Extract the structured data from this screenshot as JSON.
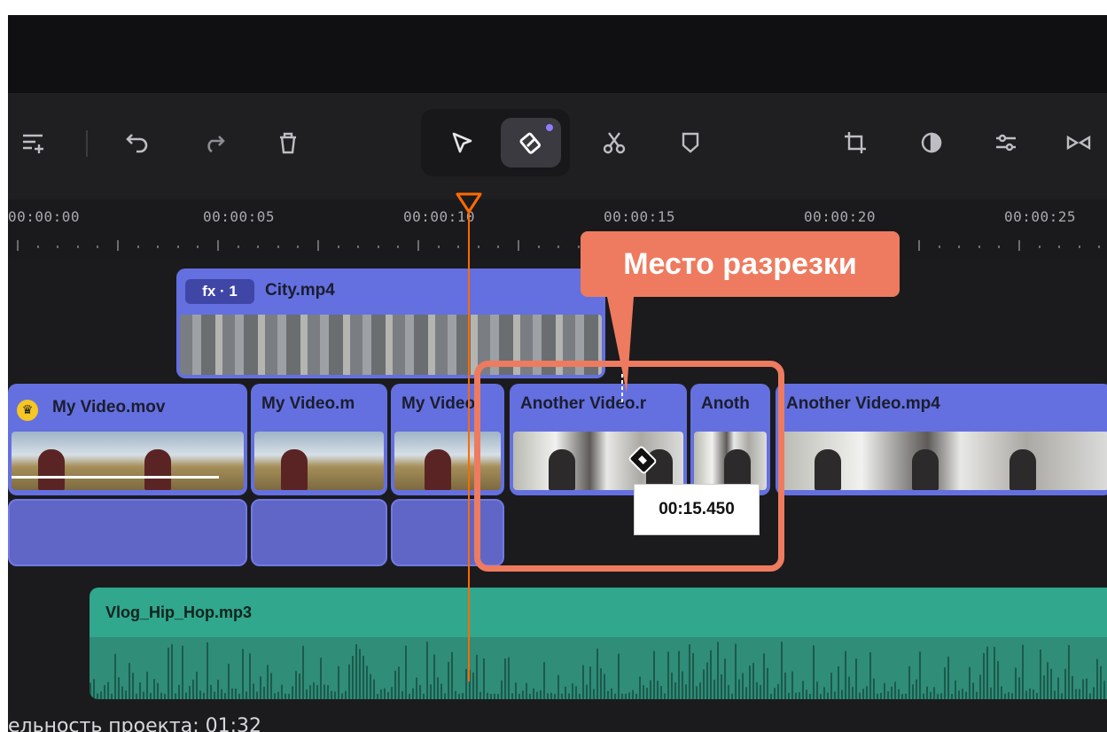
{
  "toolbar": {
    "icons": [
      "add-track-icon",
      "undo-icon",
      "redo-icon",
      "delete-icon",
      "select-icon",
      "blade-icon",
      "scissors-icon",
      "marker-icon",
      "crop-icon",
      "color-icon",
      "adjust-icon",
      "transition-icon"
    ]
  },
  "ruler": {
    "labels": [
      "00:00:00",
      "00:00:05",
      "00:00:10",
      "00:00:15",
      "00:00:20",
      "00:00:25"
    ]
  },
  "tracks": {
    "overlay_clip": {
      "badge": "fx · 1",
      "title": "City.mp4"
    },
    "main_clips": [
      {
        "title": "My Video.mov"
      },
      {
        "title": "My Video.m"
      },
      {
        "title": "My Video."
      },
      {
        "title": "Another Video.r"
      },
      {
        "title": "Anoth"
      },
      {
        "title": "Another Video.mp4"
      }
    ],
    "audio_clip": {
      "title": "Vlog_Hip_Hop.mp3"
    }
  },
  "annotation": {
    "callout_text": "Место разрезки",
    "cut_time": "00:15.450"
  },
  "status": {
    "project_duration": "ельность проекта: 01:32"
  },
  "colors": {
    "accent_orange": "#ff6a00",
    "highlight": "#ee7b5f",
    "video_clip": "#6470e0",
    "audio_clip": "#31a78d"
  }
}
